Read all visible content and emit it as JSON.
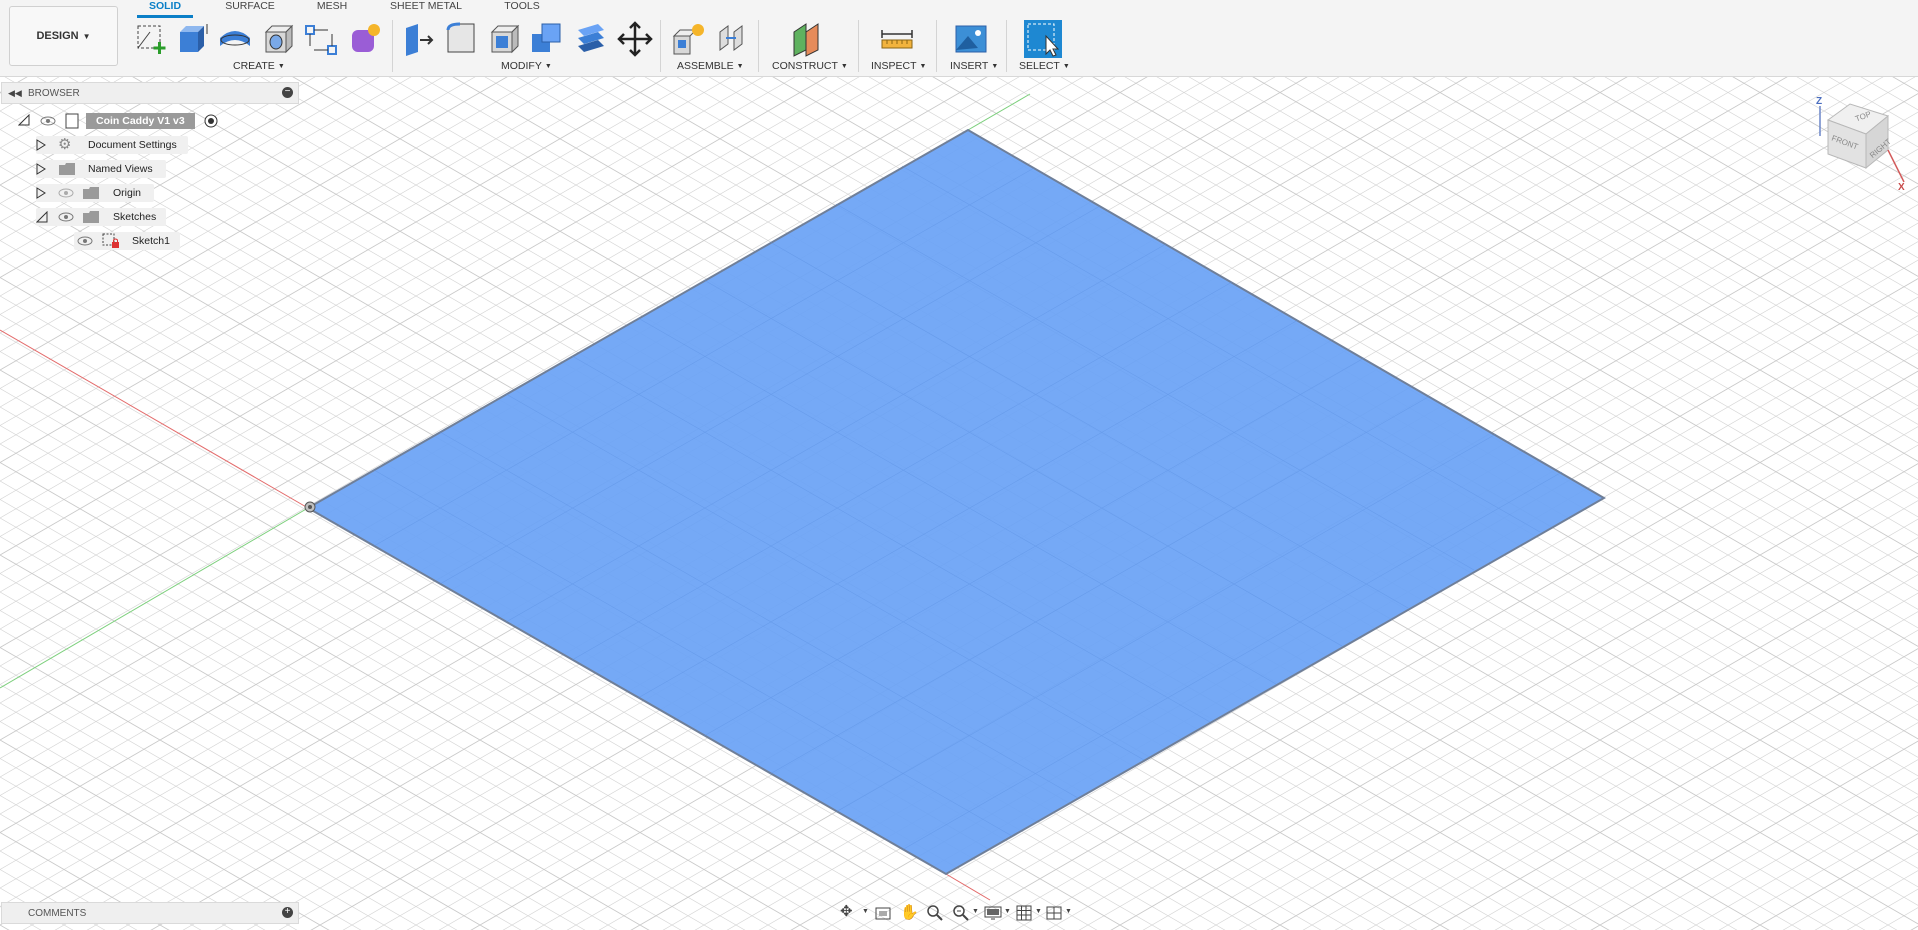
{
  "app": {
    "mode_button": "DESIGN"
  },
  "tabs": [
    {
      "label": "SOLID",
      "active": true
    },
    {
      "label": "SURFACE"
    },
    {
      "label": "MESH"
    },
    {
      "label": "SHEET METAL"
    },
    {
      "label": "TOOLS"
    }
  ],
  "groups": {
    "create": "CREATE",
    "modify": "MODIFY",
    "assemble": "ASSEMBLE",
    "construct": "CONSTRUCT",
    "inspect": "INSPECT",
    "insert": "INSERT",
    "select": "SELECT"
  },
  "browser": {
    "title": "BROWSER",
    "root": "Coin Caddy V1 v3",
    "items": [
      {
        "label": "Document Settings"
      },
      {
        "label": "Named Views"
      },
      {
        "label": "Origin"
      },
      {
        "label": "Sketches"
      },
      {
        "label": "Sketch1"
      }
    ]
  },
  "comments": {
    "title": "COMMENTS"
  },
  "viewcube": {
    "top": "TOP",
    "front": "FRONT",
    "right": "RIGHT",
    "axis_z": "Z",
    "axis_x": "X"
  },
  "colors": {
    "accent": "#0b7fc7",
    "plane_fill": "#6aa3f5",
    "plane_edge": "#6f7f99"
  }
}
